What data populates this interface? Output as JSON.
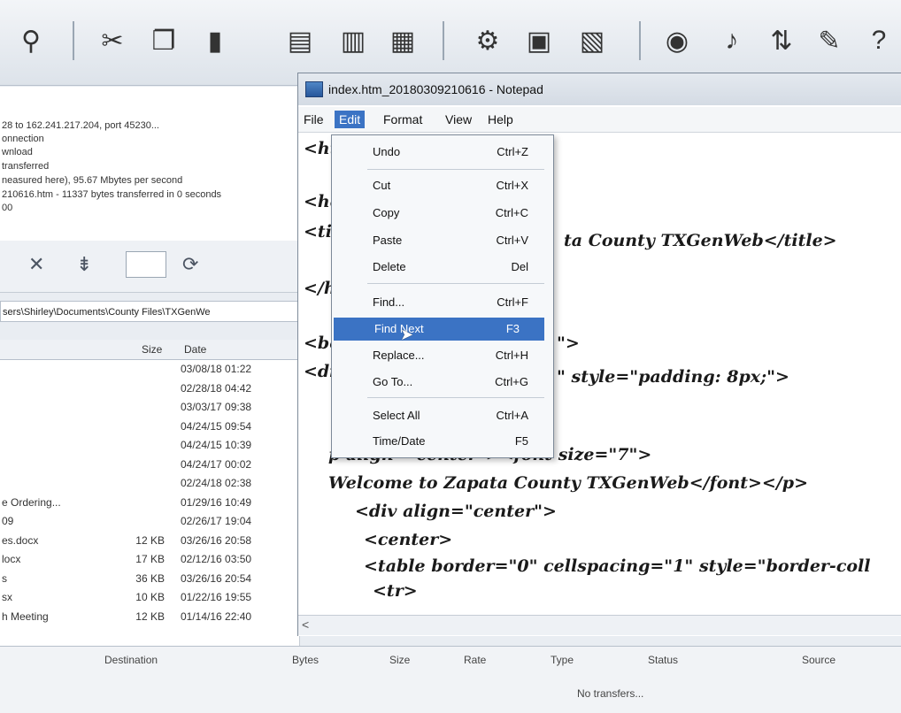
{
  "ftp": {
    "log_lines": [
      "28 to 162.241.217.204, port 45230...",
      "onnection",
      "wnload",
      "transferred",
      "neasured here), 95.67 Mbytes per second",
      "210616.htm - 11337 bytes transferred in 0 seconds",
      "00"
    ],
    "nav_close": "✕",
    "nav_download": "⇟",
    "nav_refresh": "⟳",
    "path": "sers\\Shirley\\Documents\\County Files\\TXGenWe",
    "file_headers": {
      "size": "Size",
      "date": "Date"
    },
    "files": [
      {
        "name": "",
        "size": "",
        "date": "03/08/18 01:22"
      },
      {
        "name": "",
        "size": "",
        "date": "02/28/18 04:42"
      },
      {
        "name": "",
        "size": "",
        "date": "03/03/17 09:38"
      },
      {
        "name": "",
        "size": "",
        "date": "04/24/15 09:54"
      },
      {
        "name": "",
        "size": "",
        "date": "04/24/15 10:39"
      },
      {
        "name": "",
        "size": "",
        "date": "04/24/17 00:02"
      },
      {
        "name": "",
        "size": "",
        "date": "02/24/18 02:38"
      },
      {
        "name": "e Ordering...",
        "size": "",
        "date": "01/29/16 10:49"
      },
      {
        "name": "09",
        "size": "",
        "date": "02/26/17 19:04"
      },
      {
        "name": "es.docx",
        "size": "12 KB",
        "date": "03/26/16 20:58"
      },
      {
        "name": "locx",
        "size": "17 KB",
        "date": "02/12/16 03:50"
      },
      {
        "name": "s",
        "size": "36 KB",
        "date": "03/26/16 20:54"
      },
      {
        "name": "sx",
        "size": "10 KB",
        "date": "01/22/16 19:55"
      },
      {
        "name": "h Meeting",
        "size": "12 KB",
        "date": "01/14/16 22:40"
      }
    ],
    "queue_headers": {
      "destination": "Destination",
      "bytes": "Bytes",
      "size": "Size",
      "rate": "Rate",
      "type": "Type",
      "status": "Status",
      "source": "Source"
    },
    "queue_status": "No transfers..."
  },
  "notepad": {
    "title": "index.htm_20180309210616 - Notepad",
    "menus": [
      "File",
      "Edit",
      "Format",
      "View",
      "Help"
    ],
    "code_lines": [
      "<ht",
      "<he",
      "<ti",
      "ta County TXGenWeb</title>",
      "</h",
      "<bo",
      "\">",
      "<di",
      "\" style=\"padding: 8px;\">",
      "p align=\"center\"><font size=\"7\">",
      "Welcome to Zapata County TXGenWeb</font></p>",
      "<div align=\"center\">",
      "<center>",
      "<table border=\"0\" cellspacing=\"1\" style=\"border-coll",
      "<tr>"
    ],
    "scroll_left": "<"
  },
  "edit_menu": {
    "items": [
      {
        "label": "Undo",
        "shortcut": "Ctrl+Z"
      },
      {
        "label": "Cut",
        "shortcut": "Ctrl+X"
      },
      {
        "label": "Copy",
        "shortcut": "Ctrl+C"
      },
      {
        "label": "Paste",
        "shortcut": "Ctrl+V"
      },
      {
        "label": "Delete",
        "shortcut": "Del"
      },
      {
        "label": "Find...",
        "shortcut": "Ctrl+F"
      },
      {
        "label": "Find Next",
        "shortcut": "F3"
      },
      {
        "label": "Replace...",
        "shortcut": "Ctrl+H"
      },
      {
        "label": "Go To...",
        "shortcut": "Ctrl+G"
      },
      {
        "label": "Select All",
        "shortcut": "Ctrl+A"
      },
      {
        "label": "Time/Date",
        "shortcut": "F5"
      }
    ],
    "highlight_color": "#3b73c4"
  }
}
